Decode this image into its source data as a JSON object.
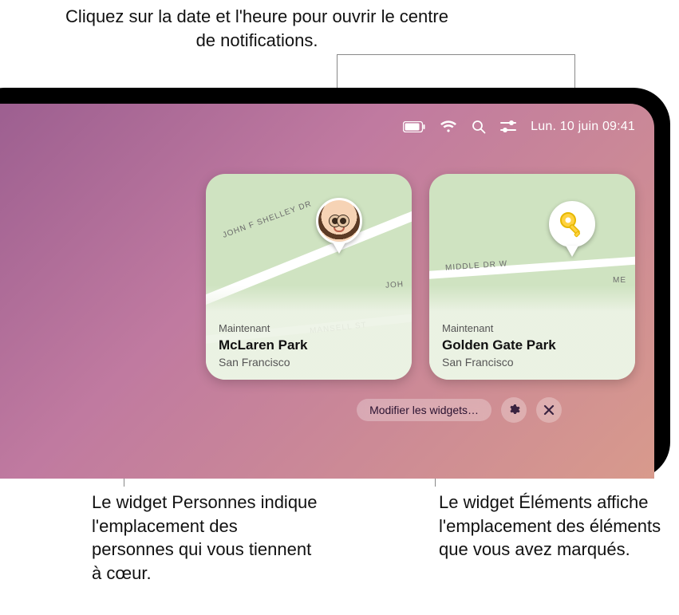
{
  "callouts": {
    "top": "Cliquez sur la date et l'heure pour ouvrir le centre de notifications.",
    "bottom_left": "Le widget Personnes indique l'emplacement des personnes qui vous tiennent à cœur.",
    "bottom_right": "Le widget Éléments affiche l'emplacement des éléments que vous avez marqués."
  },
  "menubar": {
    "icons": [
      "battery-icon",
      "wifi-icon",
      "search-icon",
      "control-center-icon"
    ],
    "datetime": "Lun. 10 juin 09:41"
  },
  "widgets": {
    "people": {
      "time_label": "Maintenant",
      "title": "McLaren Park",
      "subtitle": "San Francisco",
      "road_labels": [
        "JOHN F SHELLEY DR",
        "MANSELL ST",
        "JOH"
      ],
      "pin_type": "memoji"
    },
    "items": {
      "time_label": "Maintenant",
      "title": "Golden Gate Park",
      "subtitle": "San Francisco",
      "road_labels": [
        "MIDDLE DR W",
        "ME"
      ],
      "pin_type": "key"
    }
  },
  "toolbar": {
    "edit_label": "Modifier les widgets…"
  }
}
